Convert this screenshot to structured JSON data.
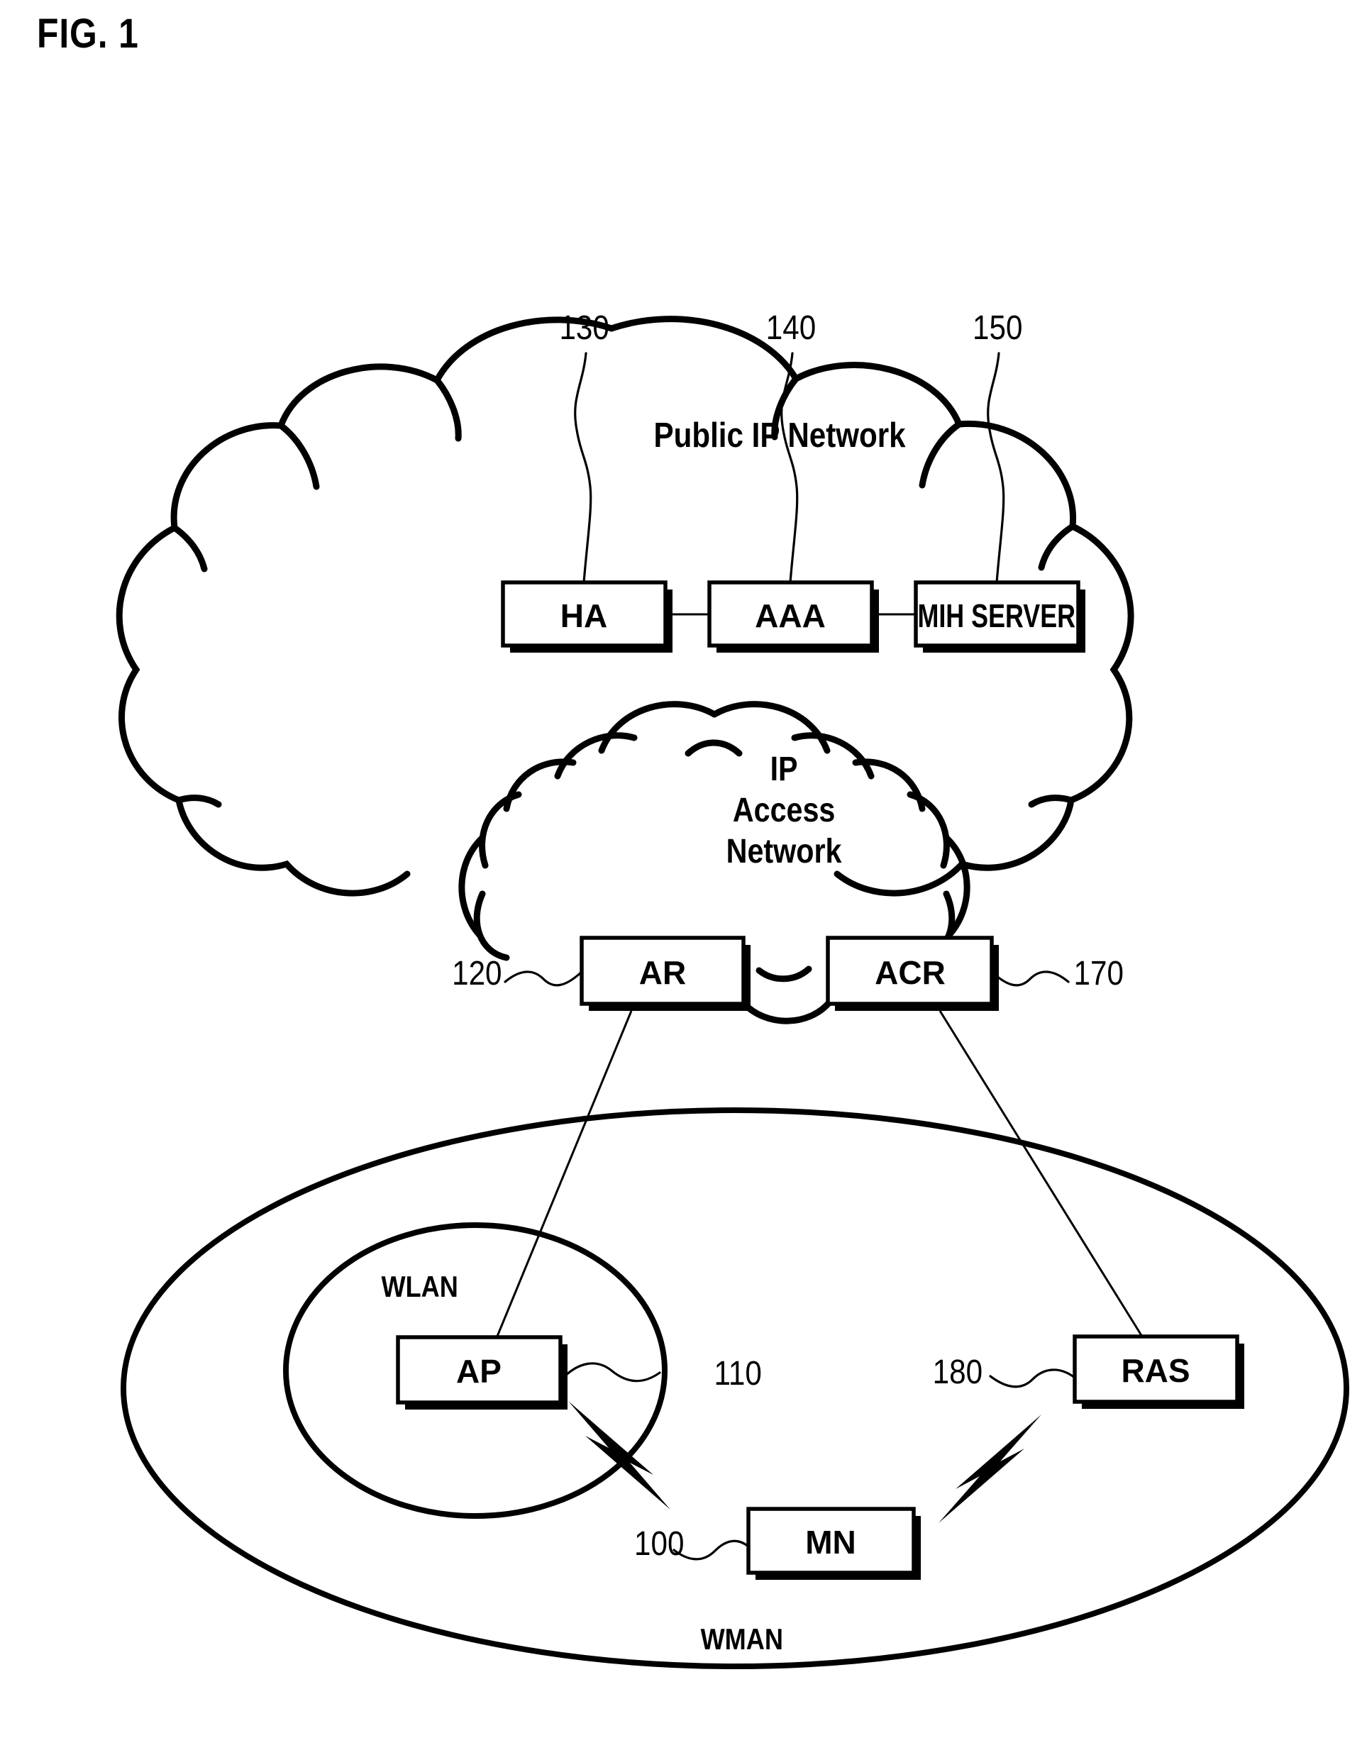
{
  "figure": {
    "title": "FIG. 1",
    "domain": "patent network architecture diagram"
  },
  "clouds": [
    {
      "id": "public-ip-network",
      "label": "Public IP Network",
      "style": "solid-cloud"
    },
    {
      "id": "ip-access-network",
      "label_lines": [
        "IP",
        "Access",
        "Network"
      ],
      "label": "IP Access Network",
      "style": "dashed-cloud"
    }
  ],
  "areas": [
    {
      "id": "wlan",
      "label": "WLAN",
      "shape": "ellipse"
    },
    {
      "id": "wman",
      "label": "WMAN",
      "shape": "ellipse"
    }
  ],
  "nodes": [
    {
      "id": "ha",
      "label": "HA",
      "ref": "130"
    },
    {
      "id": "aaa",
      "label": "AAA",
      "ref": "140"
    },
    {
      "id": "mih-server",
      "label": "MIH SERVER",
      "ref": "150"
    },
    {
      "id": "ar",
      "label": "AR",
      "ref": "120"
    },
    {
      "id": "acr",
      "label": "ACR",
      "ref": "170"
    },
    {
      "id": "ap",
      "label": "AP",
      "ref": "110"
    },
    {
      "id": "ras",
      "label": "RAS",
      "ref": "180"
    },
    {
      "id": "mn",
      "label": "MN",
      "ref": "100"
    }
  ],
  "reference_numerals": {
    "mn": "100",
    "ap": "110",
    "ar": "120",
    "ha": "130",
    "aaa": "140",
    "mih_server": "150",
    "acr": "170",
    "ras": "180"
  },
  "links": [
    {
      "from": "ha",
      "to": "aaa",
      "type": "wired"
    },
    {
      "from": "aaa",
      "to": "mih-server",
      "type": "wired"
    },
    {
      "from": "ar",
      "to": "ap",
      "type": "wired"
    },
    {
      "from": "acr",
      "to": "ras",
      "type": "wired"
    },
    {
      "from": "ap",
      "to": "mn",
      "type": "wireless"
    },
    {
      "from": "ras",
      "to": "mn",
      "type": "wireless"
    }
  ],
  "colors": {
    "stroke": "#000000",
    "background": "#ffffff",
    "fill": "#ffffff"
  }
}
